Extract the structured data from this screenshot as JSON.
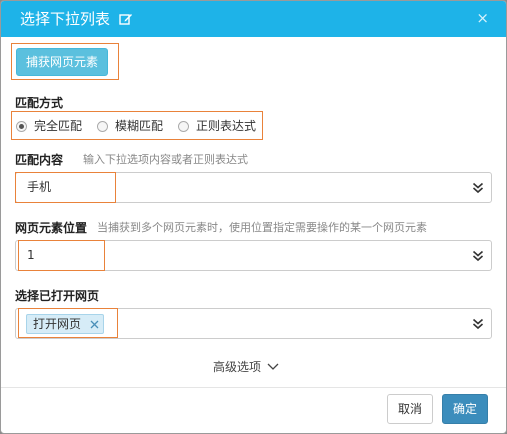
{
  "dialog": {
    "title": "选择下拉列表",
    "close_label": "×",
    "capture_button": "捕获网页元素"
  },
  "match_mode": {
    "label": "匹配方式",
    "options": [
      {
        "label": "完全匹配",
        "checked": true
      },
      {
        "label": "模糊匹配",
        "checked": false
      },
      {
        "label": "正则表达式",
        "checked": false
      }
    ]
  },
  "match_content": {
    "label": "匹配内容",
    "hint": "输入下拉选项内容或者正则表达式",
    "value": "手机"
  },
  "element_position": {
    "label": "网页元素位置",
    "hint": "当捕获到多个网页元素时，使用位置指定需要操作的某一个网页元素",
    "value": "1"
  },
  "opened_page": {
    "label": "选择已打开网页",
    "tag": "打开网页"
  },
  "advanced": {
    "label": "高级选项"
  },
  "footer": {
    "cancel": "取消",
    "ok": "确定"
  },
  "colors": {
    "titlebar": "#1eb3e8",
    "capture_button": "#5bc0de",
    "highlight": "#e9823a",
    "ok_button": "#3c8dbc"
  }
}
